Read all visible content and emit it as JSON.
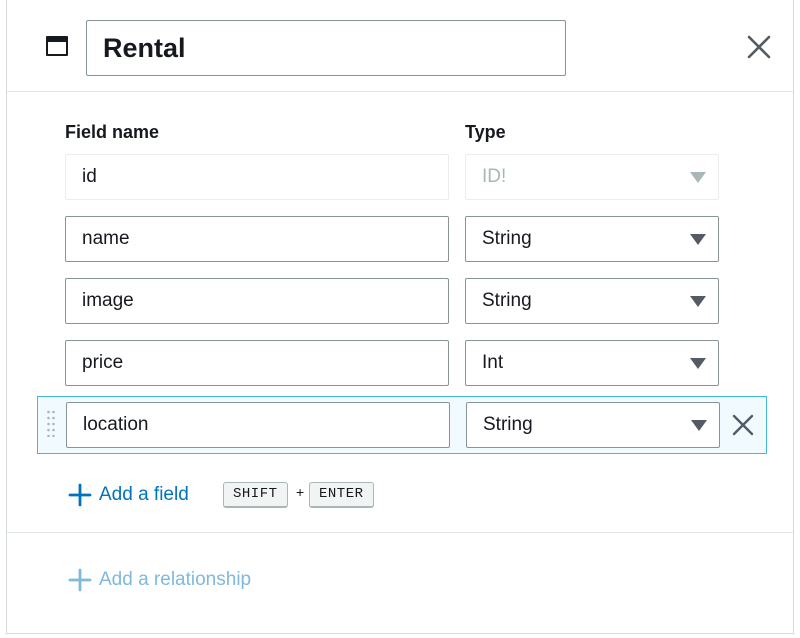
{
  "model": {
    "name": "Rental",
    "icon": "model-window-icon"
  },
  "columns": {
    "field_name": "Field name",
    "type": "Type"
  },
  "fields": [
    {
      "name": "id",
      "type": "ID!",
      "disabled": true
    },
    {
      "name": "name",
      "type": "String"
    },
    {
      "name": "image",
      "type": "String"
    },
    {
      "name": "price",
      "type": "Int"
    },
    {
      "name": "location",
      "type": "String",
      "active": true
    }
  ],
  "actions": {
    "add_field": "Add a field",
    "shortcut_key1": "SHIFT",
    "shortcut_plus": "+",
    "shortcut_key2": "ENTER",
    "add_relationship": "Add a relationship"
  },
  "colors": {
    "link": "#0073bb",
    "link_disabled": "#7fb9dd",
    "active_border": "#44b9d6",
    "active_bg": "#f1faff"
  }
}
